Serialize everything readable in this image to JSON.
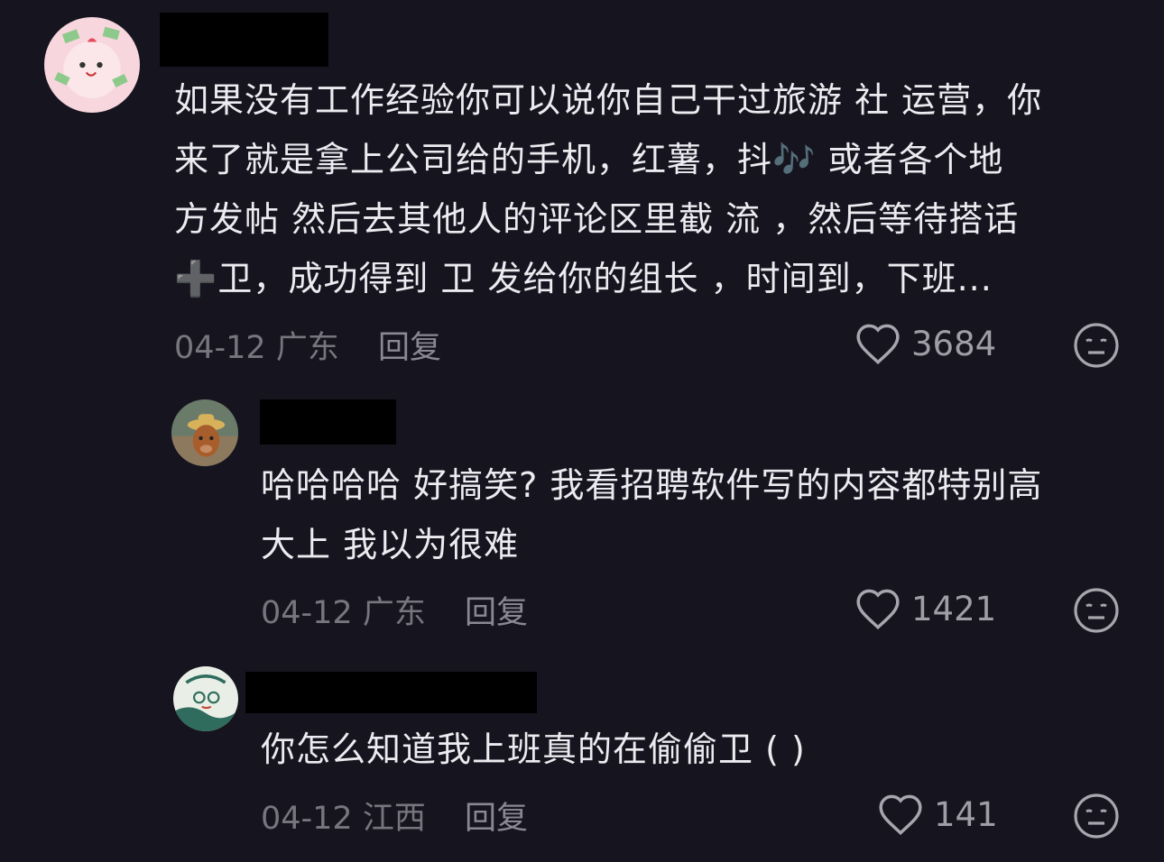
{
  "comments": [
    {
      "lines": [
        "如果没有工作经验你可以说你自己干过旅游 社 运营，你",
        "来了就是拿上公司给的手机，红薯，抖",
        "方发帖 然后去其他人的评论区里截  流 ，然后等待搭话",
        "卫，成功得到  卫 发给你的组长 ，时间到，下班..."
      ],
      "line2_tail": " 或者各个地",
      "music_icon": "🎶",
      "plus_icon": "➕",
      "date": "04-12",
      "location": "广东",
      "reply_label": "回复",
      "likes": "3684"
    },
    {
      "lines": [
        "哈哈哈哈 好搞笑? 我看招聘软件写的内容都特别高",
        "大上 我以为很难"
      ],
      "date": "04-12",
      "location": "广东",
      "reply_label": "回复",
      "likes": "1421"
    },
    {
      "lines": [
        "你怎么知道我上班真的在偷偷卫 ( )"
      ],
      "date": "04-12",
      "location": "江西",
      "reply_label": "回复",
      "likes": "141"
    }
  ],
  "icons": {
    "like": "heart-outline-icon",
    "dislike": "meh-face-icon"
  },
  "colors": {
    "background": "#16151f",
    "text": "#ecebf0",
    "meta": "#77767f"
  }
}
